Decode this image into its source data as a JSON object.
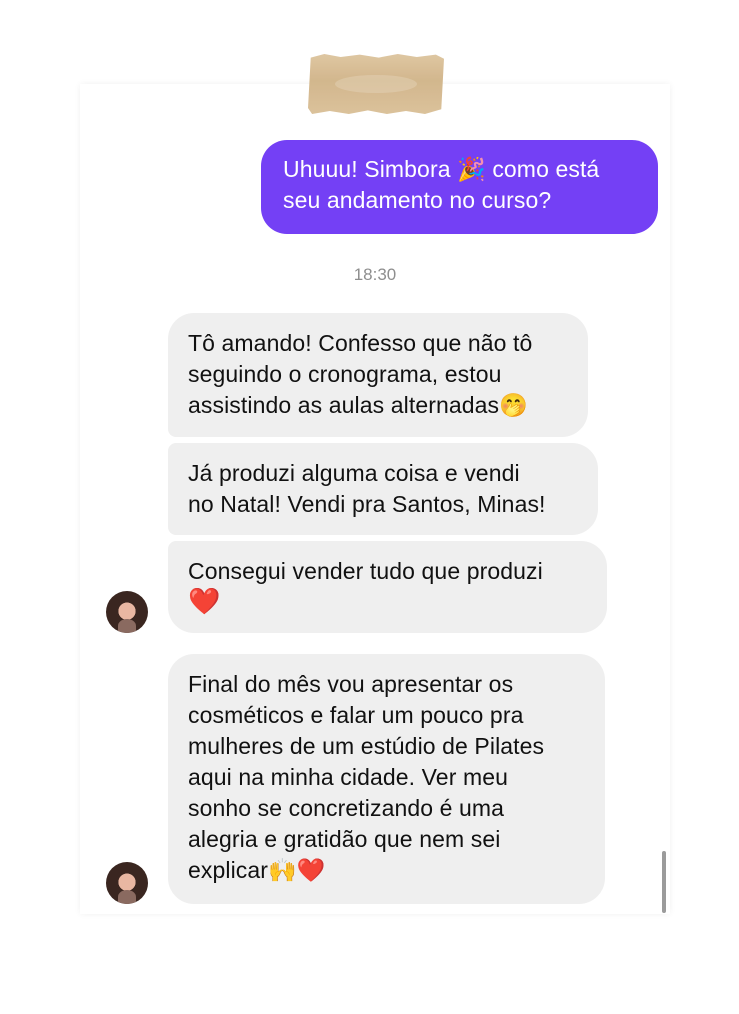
{
  "messages": [
    {
      "lines": [
        "Uhuuu! Simbora 🎉 como está",
        "seu andamento no curso?"
      ]
    },
    {
      "lines": [
        "Tô amando! Confesso que não tô",
        "seguindo o cronograma, estou",
        "assistindo as aulas alternadas🤭"
      ]
    },
    {
      "lines": [
        "Já produzi alguma coisa e vendi",
        "no Natal! Vendi pra Santos, Minas!"
      ]
    },
    {
      "lines": [
        "Consegui vender tudo que produzi",
        "❤️"
      ]
    },
    {
      "lines": [
        "Final do mês vou apresentar os",
        "cosméticos e falar um pouco pra",
        "mulheres de um estúdio de Pilates",
        "aqui na minha cidade. Ver meu",
        "sonho se concretizando é uma",
        "alegria e gratidão que nem sei",
        "explicar🙌❤️"
      ]
    }
  ],
  "timestamp": "18:30",
  "colors": {
    "outgoing_bubble": "#7440f5",
    "incoming_bubble": "#efefef",
    "timestamp_text": "#8e8e8e"
  },
  "icons": {
    "tape": "masking-tape-strip",
    "avatar": "user-avatar-photo"
  }
}
